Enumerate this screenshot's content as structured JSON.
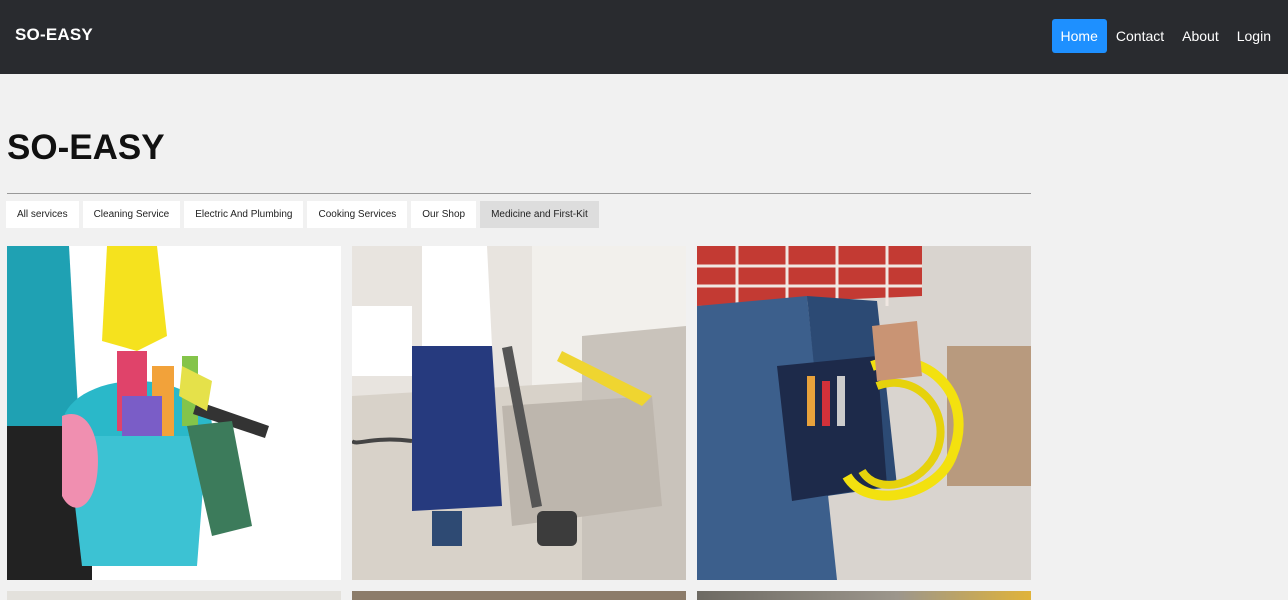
{
  "navbar": {
    "brand": "SO-EASY",
    "links": [
      {
        "label": "Home",
        "active": true
      },
      {
        "label": "Contact"
      },
      {
        "label": "About"
      },
      {
        "label": "Login"
      }
    ],
    "active_color": "#1e90ff",
    "background": "#292b2f"
  },
  "main": {
    "title": "SO-EASY",
    "filters": [
      {
        "label": "All services"
      },
      {
        "label": "Cleaning Service"
      },
      {
        "label": "Electric And Plumbing"
      },
      {
        "label": "Cooking Services"
      },
      {
        "label": "Our Shop"
      },
      {
        "label": "Medicine and First-Kit",
        "selected": true
      }
    ],
    "gallery": [
      {
        "subject": "cleaning-supplies-bucket"
      },
      {
        "subject": "vacuuming-sofa"
      },
      {
        "subject": "electrician-with-cable"
      }
    ]
  }
}
